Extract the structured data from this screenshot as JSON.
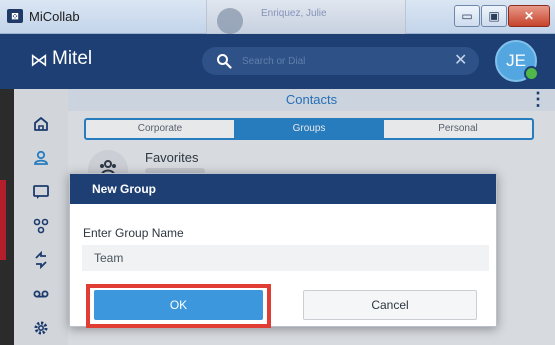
{
  "window": {
    "title": "MiCollab",
    "app_icon_glyph": "⊠",
    "minimize_glyph": "▭",
    "maximize_glyph": "▣",
    "close_glyph": "✕",
    "background_window_title": "Enriquez, Julie"
  },
  "header": {
    "brand_icon_glyph": "⋈",
    "brand": "Mitel",
    "search": {
      "placeholder": "Search or Dial",
      "value": "",
      "icon": "search-icon",
      "clear_glyph": "✕"
    },
    "avatar_initials": "JE",
    "presence_color": "#4fb848"
  },
  "sidebar": {
    "items": [
      {
        "icon": "home-icon"
      },
      {
        "icon": "contacts-icon",
        "active": true
      },
      {
        "icon": "chat-icon"
      },
      {
        "icon": "conference-icon"
      },
      {
        "icon": "call-history-icon"
      },
      {
        "icon": "voicemail-icon"
      },
      {
        "icon": "settings-icon"
      }
    ]
  },
  "contacts": {
    "title": "Contacts",
    "more_glyph": "⋮",
    "tabs": [
      {
        "label": "Corporate",
        "active": false
      },
      {
        "label": "Groups",
        "active": true
      },
      {
        "label": "Personal",
        "active": false
      }
    ],
    "favorites_label": "Favorites"
  },
  "dialog": {
    "title": "New Group",
    "field_label": "Enter Group Name",
    "field_value": "Team",
    "ok_label": "OK",
    "cancel_label": "Cancel"
  },
  "colors": {
    "header": "#1e3f74",
    "accent": "#2a87cf",
    "ok": "#3d97dc",
    "highlight": "#e03d35"
  }
}
